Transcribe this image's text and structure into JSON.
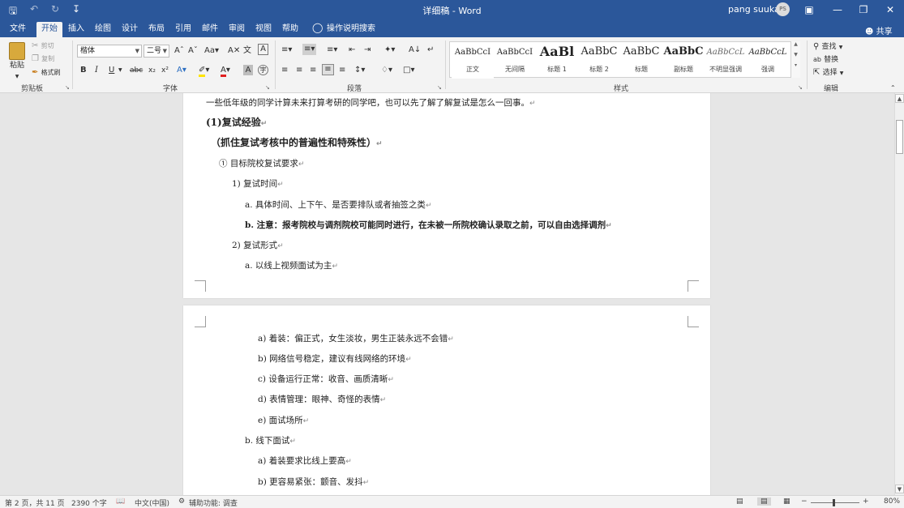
{
  "window": {
    "title": "详细稿 - Word",
    "user_name": "pang suukai",
    "avatar_initials": "PS"
  },
  "tabs": [
    {
      "label": "文件"
    },
    {
      "label": "开始"
    },
    {
      "label": "插入"
    },
    {
      "label": "绘图"
    },
    {
      "label": "设计"
    },
    {
      "label": "布局"
    },
    {
      "label": "引用"
    },
    {
      "label": "邮件"
    },
    {
      "label": "审阅"
    },
    {
      "label": "视图"
    },
    {
      "label": "帮助"
    }
  ],
  "tell_me": "操作说明搜索",
  "share_label": "共享",
  "ribbon": {
    "clipboard": {
      "label": "剪贴板",
      "paste": "粘贴",
      "cut": "剪切",
      "copy": "复制",
      "format_painter": "格式刷"
    },
    "font": {
      "label": "字体",
      "font_name": "楷体",
      "font_size": "二号"
    },
    "paragraph": {
      "label": "段落"
    },
    "styles": {
      "label": "样式",
      "items": [
        {
          "sample": "AaBbCcI",
          "name": "正文"
        },
        {
          "sample": "AaBbCcI",
          "name": "无间隔"
        },
        {
          "sample": "AaBl",
          "name": "标题 1"
        },
        {
          "sample": "AaBbC",
          "name": "标题 2"
        },
        {
          "sample": "AaBbC",
          "name": "标题"
        },
        {
          "sample": "AaBbC",
          "name": "副标题"
        },
        {
          "sample": "AaBbCcL",
          "name": "不明显强调"
        },
        {
          "sample": "AaBbCcL",
          "name": "强调"
        }
      ]
    },
    "editing": {
      "label": "编辑",
      "find": "查找",
      "replace": "替换",
      "select": "选择"
    }
  },
  "document": {
    "page1": [
      "一些低年级的同学计算未来打算考研的同学吧，也可以先了解了解复试是怎么一回事。",
      "(1)复试经验",
      "（抓住复试考核中的普遍性和特殊性）",
      "① 目标院校复试要求",
      "1)  复试时间",
      "a.  具体时间、上下午、是否要排队或者抽签之类",
      "b.  注意：报考院校与调剂院校可能同时进行，在未被一所院校确认录取之前，可以自由选择调剂",
      "2)  复试形式",
      "a.  以线上视频面试为主"
    ],
    "page2": [
      "a)  着装：偏正式，女生淡妆，男生正装永远不会错",
      "b)  网络信号稳定，建议有线网络的环境",
      "c)  设备运行正常：收音、画质清晰",
      "d)  表情管理：眼神、奇怪的表情",
      "e)  面试场所",
      "b.  线下面试",
      "a)  着装要求比线上要高",
      "b)  更容易紧张：颤音、发抖"
    ]
  },
  "status": {
    "page": "第 2 页，共 11 页",
    "words": "2390 个字",
    "language": "中文(中国)",
    "accessibility": "辅助功能: 调查",
    "zoom": "80%"
  }
}
